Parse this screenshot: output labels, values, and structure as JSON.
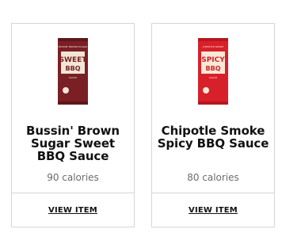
{
  "products": [
    {
      "name": "Bussin' Brown Sugar Sweet BBQ Sauce",
      "calories": "90 calories",
      "cta": "VIEW ITEM",
      "packet": {
        "top_text": "BUSSIN' BROWN SUGAR",
        "word1": "SWEET",
        "word2": "BBQ",
        "small": "SAUCE",
        "color": "#7a1f24",
        "accent": "#f1e6d6"
      }
    },
    {
      "name": "Chipotle Smoke Spicy BBQ Sauce",
      "calories": "80 calories",
      "cta": "VIEW ITEM",
      "packet": {
        "top_text": "CHIPOTLE SMOKE",
        "word1": "SPICY",
        "word2": "BBQ",
        "small": "SAUCE",
        "color": "#d8202a",
        "accent": "#f6e9d6"
      }
    }
  ]
}
